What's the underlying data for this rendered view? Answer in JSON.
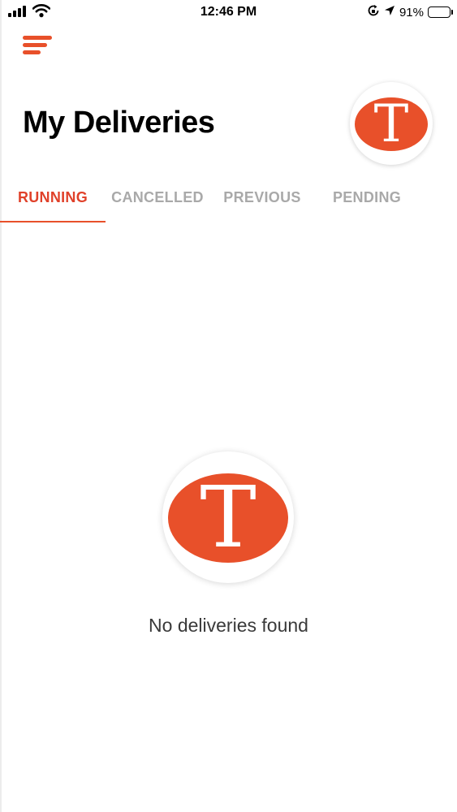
{
  "status_bar": {
    "time": "12:46 PM",
    "battery_percent": "91%",
    "battery_level": 0.91,
    "battery_color": "#f2c94c",
    "icons": [
      "cellular-signal-icon",
      "wifi-icon",
      "orientation-lock-icon",
      "location-arrow-icon",
      "battery-icon"
    ]
  },
  "header": {
    "menu_icon": "hamburger-menu-icon",
    "title": "My Deliveries",
    "avatar_letter": "T"
  },
  "tabs": [
    {
      "label": "RUNNING",
      "active": true
    },
    {
      "label": "CANCELLED",
      "active": false
    },
    {
      "label": "PREVIOUS",
      "active": false
    },
    {
      "label": "PENDING",
      "active": false
    }
  ],
  "empty_state": {
    "logo_letter": "T",
    "message": "No deliveries found"
  },
  "colors": {
    "accent": "#e8502a",
    "active_tab": "#e0412a",
    "inactive_tab": "#a9a9a9",
    "logo_fill": "#e8502a"
  }
}
